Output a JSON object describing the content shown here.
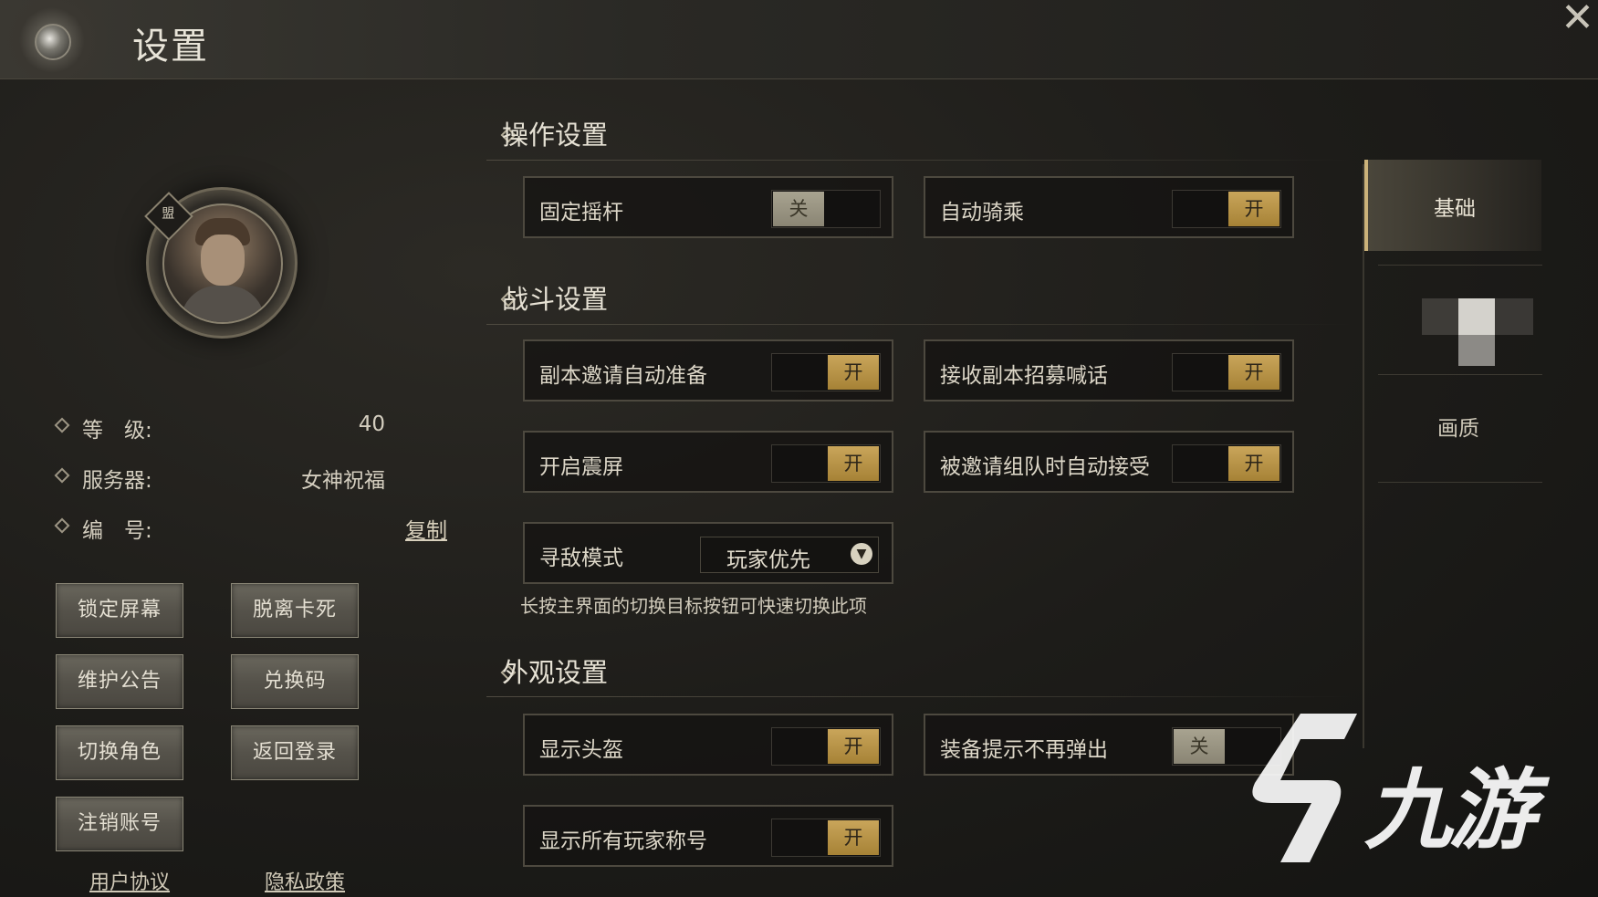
{
  "header": {
    "title": "设置",
    "close_icon": "close-icon",
    "emblem_icon": "emblem-orb-icon"
  },
  "profile": {
    "badge_text": "盟",
    "info": [
      {
        "label": "等　级:",
        "value": "40"
      },
      {
        "label": "服务器:",
        "value": "女神祝福"
      },
      {
        "label": "编　号:",
        "value": "",
        "link": "复制"
      }
    ],
    "buttons": [
      "锁定屏幕",
      "脱离卡死",
      "维护公告",
      "兑换码",
      "切换角色",
      "返回登录",
      "注销账号"
    ],
    "links": [
      "用户协议",
      "隐私政策"
    ]
  },
  "sections": {
    "operation": {
      "title": "操作设置",
      "items": [
        {
          "label": "固定摇杆",
          "state": "关",
          "on": false
        },
        {
          "label": "自动骑乘",
          "state": "开",
          "on": true
        }
      ]
    },
    "combat": {
      "title": "战斗设置",
      "items": [
        {
          "label": "副本邀请自动准备",
          "state": "开",
          "on": true
        },
        {
          "label": "接收副本招募喊话",
          "state": "开",
          "on": true
        },
        {
          "label": "开启震屏",
          "state": "开",
          "on": true
        },
        {
          "label": "被邀请组队时自动接受",
          "state": "开",
          "on": true
        }
      ],
      "target_mode": {
        "label": "寻敌模式",
        "value": "玩家优先"
      },
      "hint": "长按主界面的切换目标按钮可快速切换此项"
    },
    "appearance": {
      "title": "外观设置",
      "items": [
        {
          "label": "显示头盔",
          "state": "开",
          "on": true
        },
        {
          "label": "装备提示不再弹出",
          "state": "关",
          "on": false
        },
        {
          "label": "显示所有玩家称号",
          "state": "开",
          "on": true
        }
      ]
    }
  },
  "tabs": [
    {
      "label": "基础",
      "active": true
    },
    {
      "label": "",
      "active": false
    },
    {
      "label": "画质",
      "active": false
    }
  ],
  "watermark": {
    "text": "九游"
  },
  "colors": {
    "accent_gold": "#c9a55a",
    "toggle_off": "#a8a390",
    "panel_bg": "#1d1c19"
  }
}
